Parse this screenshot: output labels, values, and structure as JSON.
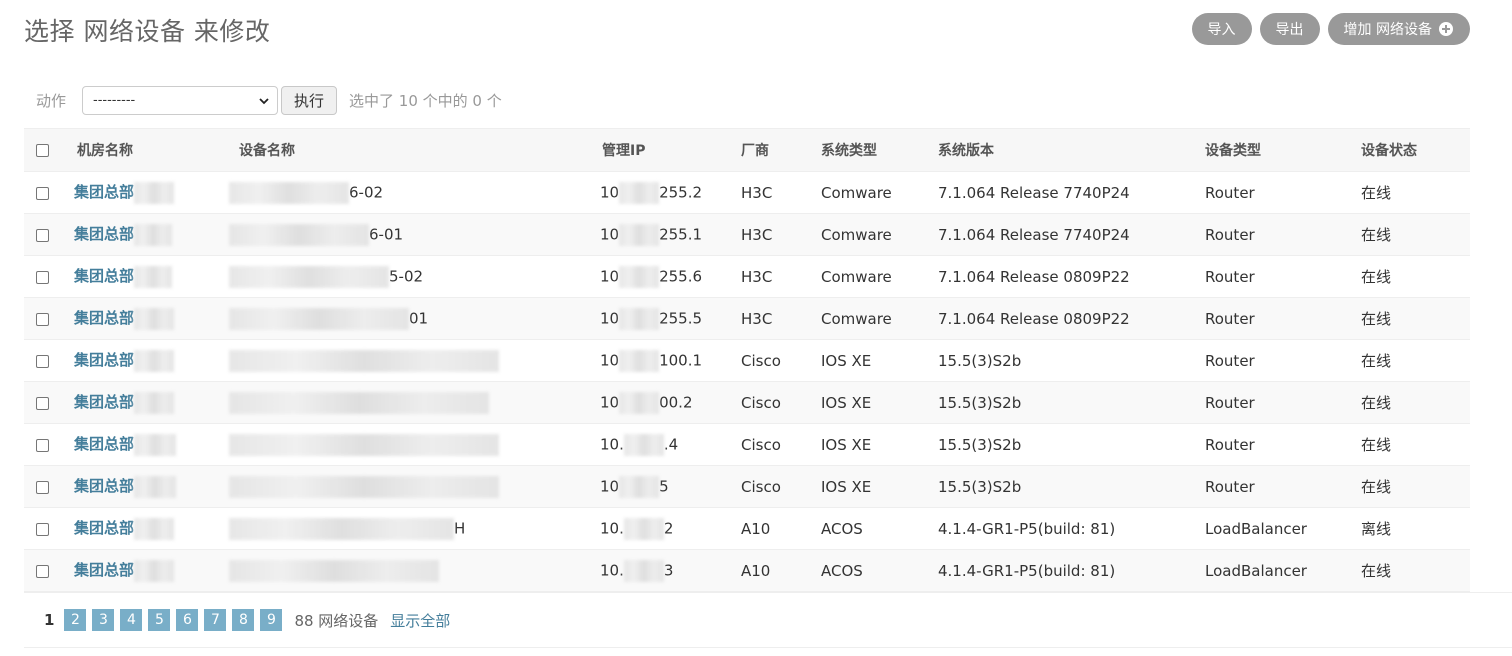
{
  "page": {
    "title": "选择 网络设备 来修改"
  },
  "object_tools": {
    "import_label": "导入",
    "export_label": "导出",
    "add_label": "增加 网络设备",
    "add_icon": "plus-icon"
  },
  "actions": {
    "label": "动作",
    "select_value": "---------",
    "run_label": "执行",
    "selection_counter": "选中了 10 个中的 0 个"
  },
  "table": {
    "columns": [
      "机房名称",
      "设备名称",
      "管理IP",
      "厂商",
      "系统类型",
      "系统版本",
      "设备类型",
      "设备状态"
    ],
    "rows": [
      {
        "room": "集团总部",
        "device_tail": "6-02",
        "ip_head": "10",
        "ip_tail": "255.2",
        "vendor": "H3C",
        "os_type": "Comware",
        "os_version": "7.1.064 Release 7740P24",
        "device_type": "Router",
        "status": "在线"
      },
      {
        "room": "集团总部",
        "device_tail": "6-01",
        "ip_head": "10",
        "ip_tail": "255.1",
        "vendor": "H3C",
        "os_type": "Comware",
        "os_version": "7.1.064 Release 7740P24",
        "device_type": "Router",
        "status": "在线"
      },
      {
        "room": "集团总部",
        "device_tail": "5-02",
        "ip_head": "10",
        "ip_tail": "255.6",
        "vendor": "H3C",
        "os_type": "Comware",
        "os_version": "7.1.064 Release 0809P22",
        "device_type": "Router",
        "status": "在线"
      },
      {
        "room": "集团总部",
        "device_tail": "01",
        "ip_head": "10",
        "ip_tail": "255.5",
        "vendor": "H3C",
        "os_type": "Comware",
        "os_version": "7.1.064 Release 0809P22",
        "device_type": "Router",
        "status": "在线"
      },
      {
        "room": "集团总部",
        "device_tail": "",
        "ip_head": "10",
        "ip_tail": "100.1",
        "vendor": "Cisco",
        "os_type": "IOS XE",
        "os_version": "15.5(3)S2b",
        "device_type": "Router",
        "status": "在线"
      },
      {
        "room": "集团总部",
        "device_tail": "",
        "ip_head": "10",
        "ip_tail": "00.2",
        "vendor": "Cisco",
        "os_type": "IOS XE",
        "os_version": "15.5(3)S2b",
        "device_type": "Router",
        "status": "在线"
      },
      {
        "room": "集团总部",
        "device_tail": "",
        "ip_head": "10.",
        "ip_tail": ".4",
        "vendor": "Cisco",
        "os_type": "IOS XE",
        "os_version": "15.5(3)S2b",
        "device_type": "Router",
        "status": "在线"
      },
      {
        "room": "集团总部",
        "device_tail": "",
        "ip_head": "10",
        "ip_tail": "5",
        "vendor": "Cisco",
        "os_type": "IOS XE",
        "os_version": "15.5(3)S2b",
        "device_type": "Router",
        "status": "在线"
      },
      {
        "room": "集团总部",
        "device_tail": "H",
        "ip_head": "10.",
        "ip_tail": "2",
        "vendor": "A10",
        "os_type": "ACOS",
        "os_version": "4.1.4-GR1-P5(build: 81)",
        "device_type": "LoadBalancer",
        "status": "离线"
      },
      {
        "room": "集团总部",
        "device_tail": "",
        "ip_head": "10.",
        "ip_tail": "3",
        "vendor": "A10",
        "os_type": "ACOS",
        "os_version": "4.1.4-GR1-P5(build: 81)",
        "device_type": "LoadBalancer",
        "status": "在线"
      }
    ]
  },
  "paginator": {
    "current_page": "1",
    "pages": [
      "2",
      "3",
      "4",
      "5",
      "6",
      "7",
      "8",
      "9"
    ],
    "result_count": "88 网络设备",
    "show_all": "显示全部"
  },
  "colors": {
    "link": "#447e9b",
    "tool_button": "#999999",
    "page_link": "#79aec8"
  }
}
